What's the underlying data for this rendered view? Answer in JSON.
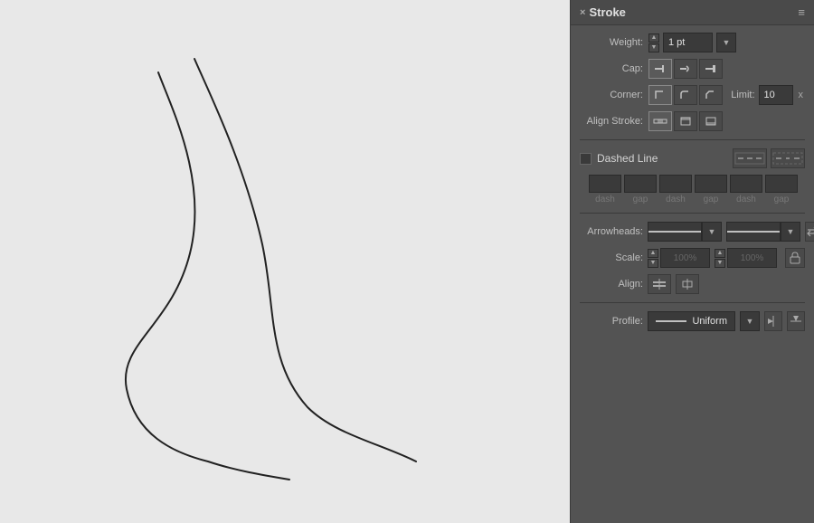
{
  "panel": {
    "title": "Stroke",
    "close_icon": "×",
    "menu_icon": "≡",
    "up_arrow": "▲",
    "down_arrow": "▼",
    "weight_label": "Weight:",
    "weight_value": "1 pt",
    "cap_label": "Cap:",
    "corner_label": "Corner:",
    "limit_label": "Limit:",
    "limit_value": "10",
    "align_stroke_label": "Align Stroke:",
    "dashed_line_label": "Dashed Line",
    "arrowheads_label": "Arrowheads:",
    "scale_label": "Scale:",
    "scale_value1": "100%",
    "scale_value2": "100%",
    "align_label": "Align:",
    "profile_label": "Profile:",
    "profile_value": "Uniform",
    "dash_labels": [
      "dash",
      "gap",
      "dash",
      "gap",
      "dash",
      "gap"
    ],
    "x_close": "x"
  }
}
